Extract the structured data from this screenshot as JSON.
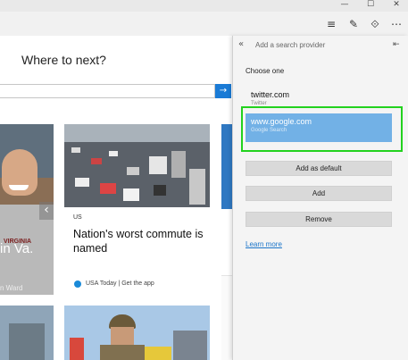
{
  "window": {
    "minimize": "—",
    "maximize": "☐",
    "close": "✕"
  },
  "toolbar": {
    "hub_icon": "≡",
    "note_icon": "✎",
    "share_icon": "⟐",
    "more_icon": "⋯"
  },
  "page": {
    "heading": "Where to next?",
    "search_go": "→",
    "left_card_caption": "in Va.",
    "left_card_sub": "n Ward",
    "carousel_arrow": "‹",
    "news": {
      "category": "US",
      "headline": "Nation's worst commute is named",
      "source": "USA Today | Get the app"
    }
  },
  "panel": {
    "back": "«",
    "title": "Add a search provider",
    "pin": "⇤",
    "choose": "Choose one",
    "providers": [
      {
        "name": "twitter.com",
        "sub": "Twitter"
      },
      {
        "name": "www.google.com",
        "sub": "Google Search"
      }
    ],
    "buttons": {
      "default": "Add as default",
      "add": "Add",
      "remove": "Remove"
    },
    "learn_more": "Learn more"
  },
  "colors": {
    "accent": "#1a7bd6",
    "selected": "#72b1e6",
    "highlight": "#22d21e"
  }
}
